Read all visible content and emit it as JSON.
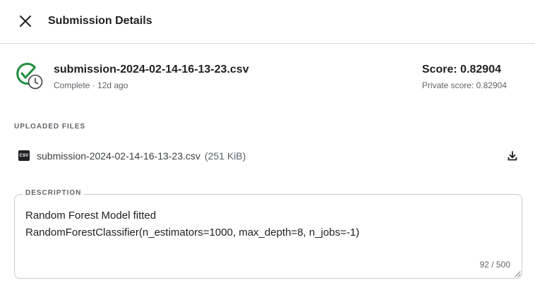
{
  "header": {
    "title": "Submission Details",
    "close_icon": "close-icon"
  },
  "submission": {
    "file_name": "submission-2024-02-14-16-13-23.csv",
    "status": "Complete · 12d ago",
    "score": "Score: 0.82904",
    "private_score": "Private score: 0.82904",
    "status_icon": "check-circle-clock-icon",
    "status_color": "#1e8e3e"
  },
  "uploaded_files": {
    "label": "UPLOADED FILES",
    "files": [
      {
        "icon_label": "CSV",
        "name": "submission-2024-02-14-16-13-23.csv",
        "size": "(251 KiB)",
        "action_icon": "download-icon"
      }
    ]
  },
  "description": {
    "label": "DESCRIPTION",
    "lines": [
      "Random Forest Model fitted",
      "RandomForestClassifier(n_estimators=1000, max_depth=8, n_jobs=-1)"
    ],
    "char_count": "92 / 500"
  }
}
